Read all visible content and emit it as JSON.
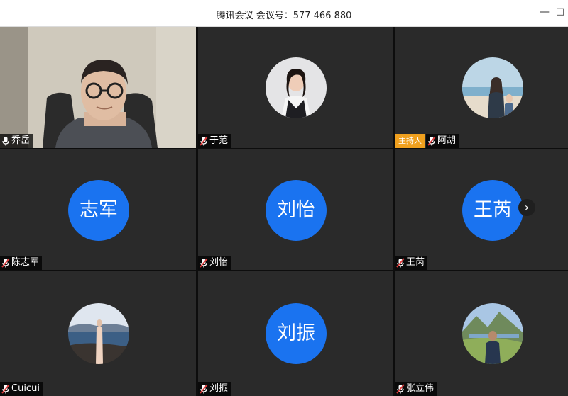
{
  "window": {
    "title": "腾讯会议 会议号：577 466 880",
    "minimize_label": "—",
    "maximize_label": "□"
  },
  "participants": [
    {
      "name": "乔岳",
      "type": "video",
      "muted": false
    },
    {
      "name": "于范",
      "type": "photo",
      "muted": true
    },
    {
      "name": "阿胡",
      "type": "photo",
      "muted": true,
      "badge": "主持人"
    },
    {
      "name": "陈志军",
      "type": "initials",
      "initials": "志军",
      "muted": true
    },
    {
      "name": "刘怡",
      "type": "initials",
      "initials": "刘怡",
      "muted": true
    },
    {
      "name": "王芮",
      "type": "initials",
      "initials": "王芮",
      "muted": true
    },
    {
      "name": "Cuicui",
      "type": "photo",
      "muted": true
    },
    {
      "name": "刘振",
      "type": "initials",
      "initials": "刘振",
      "muted": true
    },
    {
      "name": "张立伟",
      "type": "photo",
      "muted": true
    }
  ],
  "pager": {
    "next_label": "›"
  },
  "colors": {
    "avatar_blue": "#1a73f0",
    "host_badge": "#f0a01e",
    "muted_mic": "#e03b3b",
    "tile_bg": "#2a2a2a"
  }
}
